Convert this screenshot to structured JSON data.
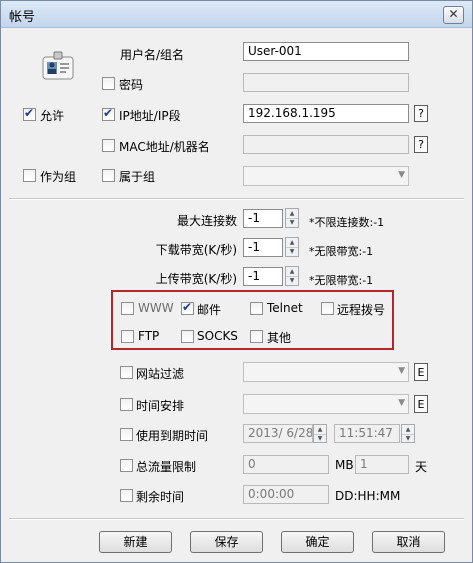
{
  "window": {
    "title": "帐号",
    "close_glyph": "✕"
  },
  "identity": {
    "username_label": "用户名/组名",
    "username_value": "User-001",
    "password_label": "密码",
    "password_value": "",
    "ip_label": "IP地址/IP段",
    "ip_value": "192.168.1.195",
    "ip_help": "?",
    "mac_label": "MAC地址/机器名",
    "mac_value": "",
    "mac_help": "?",
    "belong_label": "属于组",
    "allow_label": "允许",
    "as_group_label": "作为组"
  },
  "limits": {
    "max_conn_label": "最大连接数",
    "max_conn_value": "-1",
    "max_conn_hint": "*不限连接数:-1",
    "down_label": "下载带宽(K/秒)",
    "down_value": "-1",
    "down_hint": "*无限带宽:-1",
    "up_label": "上传带宽(K/秒)",
    "up_value": "-1",
    "up_hint": "*无限带宽:-1"
  },
  "services": {
    "www": "WWW",
    "mail": "邮件",
    "telnet": "Telnet",
    "remote_dial": "远程拨号",
    "ftp": "FTP",
    "socks": "SOCKS",
    "other": "其他"
  },
  "filters": {
    "web_filter_label": "网站过滤",
    "web_filter_btn": "E",
    "schedule_label": "时间安排",
    "schedule_btn": "E",
    "expire_label": "使用到期时间",
    "expire_date": "2013/ 6/28",
    "expire_time": "11:51:47",
    "traffic_label": "总流量限制",
    "traffic_value": "0",
    "traffic_unit": "MB",
    "traffic_days": "1",
    "traffic_days_unit": "天",
    "remain_label": "剩余时间",
    "remain_value": "0:00:00",
    "remain_format": "DD:HH:MM"
  },
  "buttons": {
    "new": "新建",
    "save": "保存",
    "ok": "确定",
    "cancel": "取消"
  },
  "colors": {
    "highlight_box": "#b3282d",
    "titlebar": "#c4d6ec"
  },
  "icons": {
    "user_card": "id-card-icon"
  }
}
